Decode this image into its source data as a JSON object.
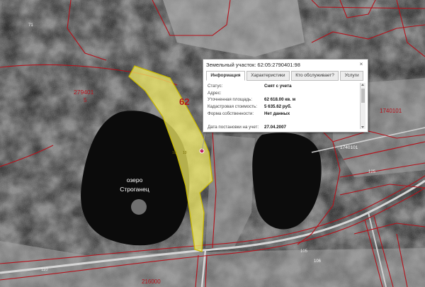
{
  "map": {
    "lake_label_line1": "озеро",
    "lake_label_line2": "Строганец",
    "parcel_number": "62",
    "parcel_small_label_1": "10",
    "parcel_small_label_2": "10",
    "block_labels": [
      "279401",
      "5",
      "1740101",
      "1740101",
      "216000",
      "71",
      "110",
      "105",
      "106",
      "125"
    ],
    "colors": {
      "parcel_fill": "#f6f066",
      "parcel_stroke": "#c8b800",
      "boundary": "#b5121b",
      "road": "#d8d8d8"
    }
  },
  "popup": {
    "title": "Земельный участок: 62:05:2790401:98",
    "close_icon": "×",
    "tabs": [
      {
        "label": "Информация",
        "active": true
      },
      {
        "label": "Характеристики",
        "active": false
      },
      {
        "label": "Кто обслуживает?",
        "active": false
      },
      {
        "label": "Услуги",
        "active": false
      }
    ],
    "rows": [
      {
        "label": "Статус:",
        "value": "Снят с учета"
      },
      {
        "label": "Адрес:",
        "value": ""
      },
      {
        "label": "Уточненная площадь:",
        "value": "62 618.00 кв. м"
      },
      {
        "label": "Кадастровая стоимость:",
        "value": "5 635.62 руб."
      },
      {
        "label": "Форма собственности:",
        "value": "Нет данных"
      },
      {
        "label": "",
        "value": ""
      },
      {
        "label": "Дата постановки на учет:",
        "value": "27.04.2007"
      }
    ]
  }
}
